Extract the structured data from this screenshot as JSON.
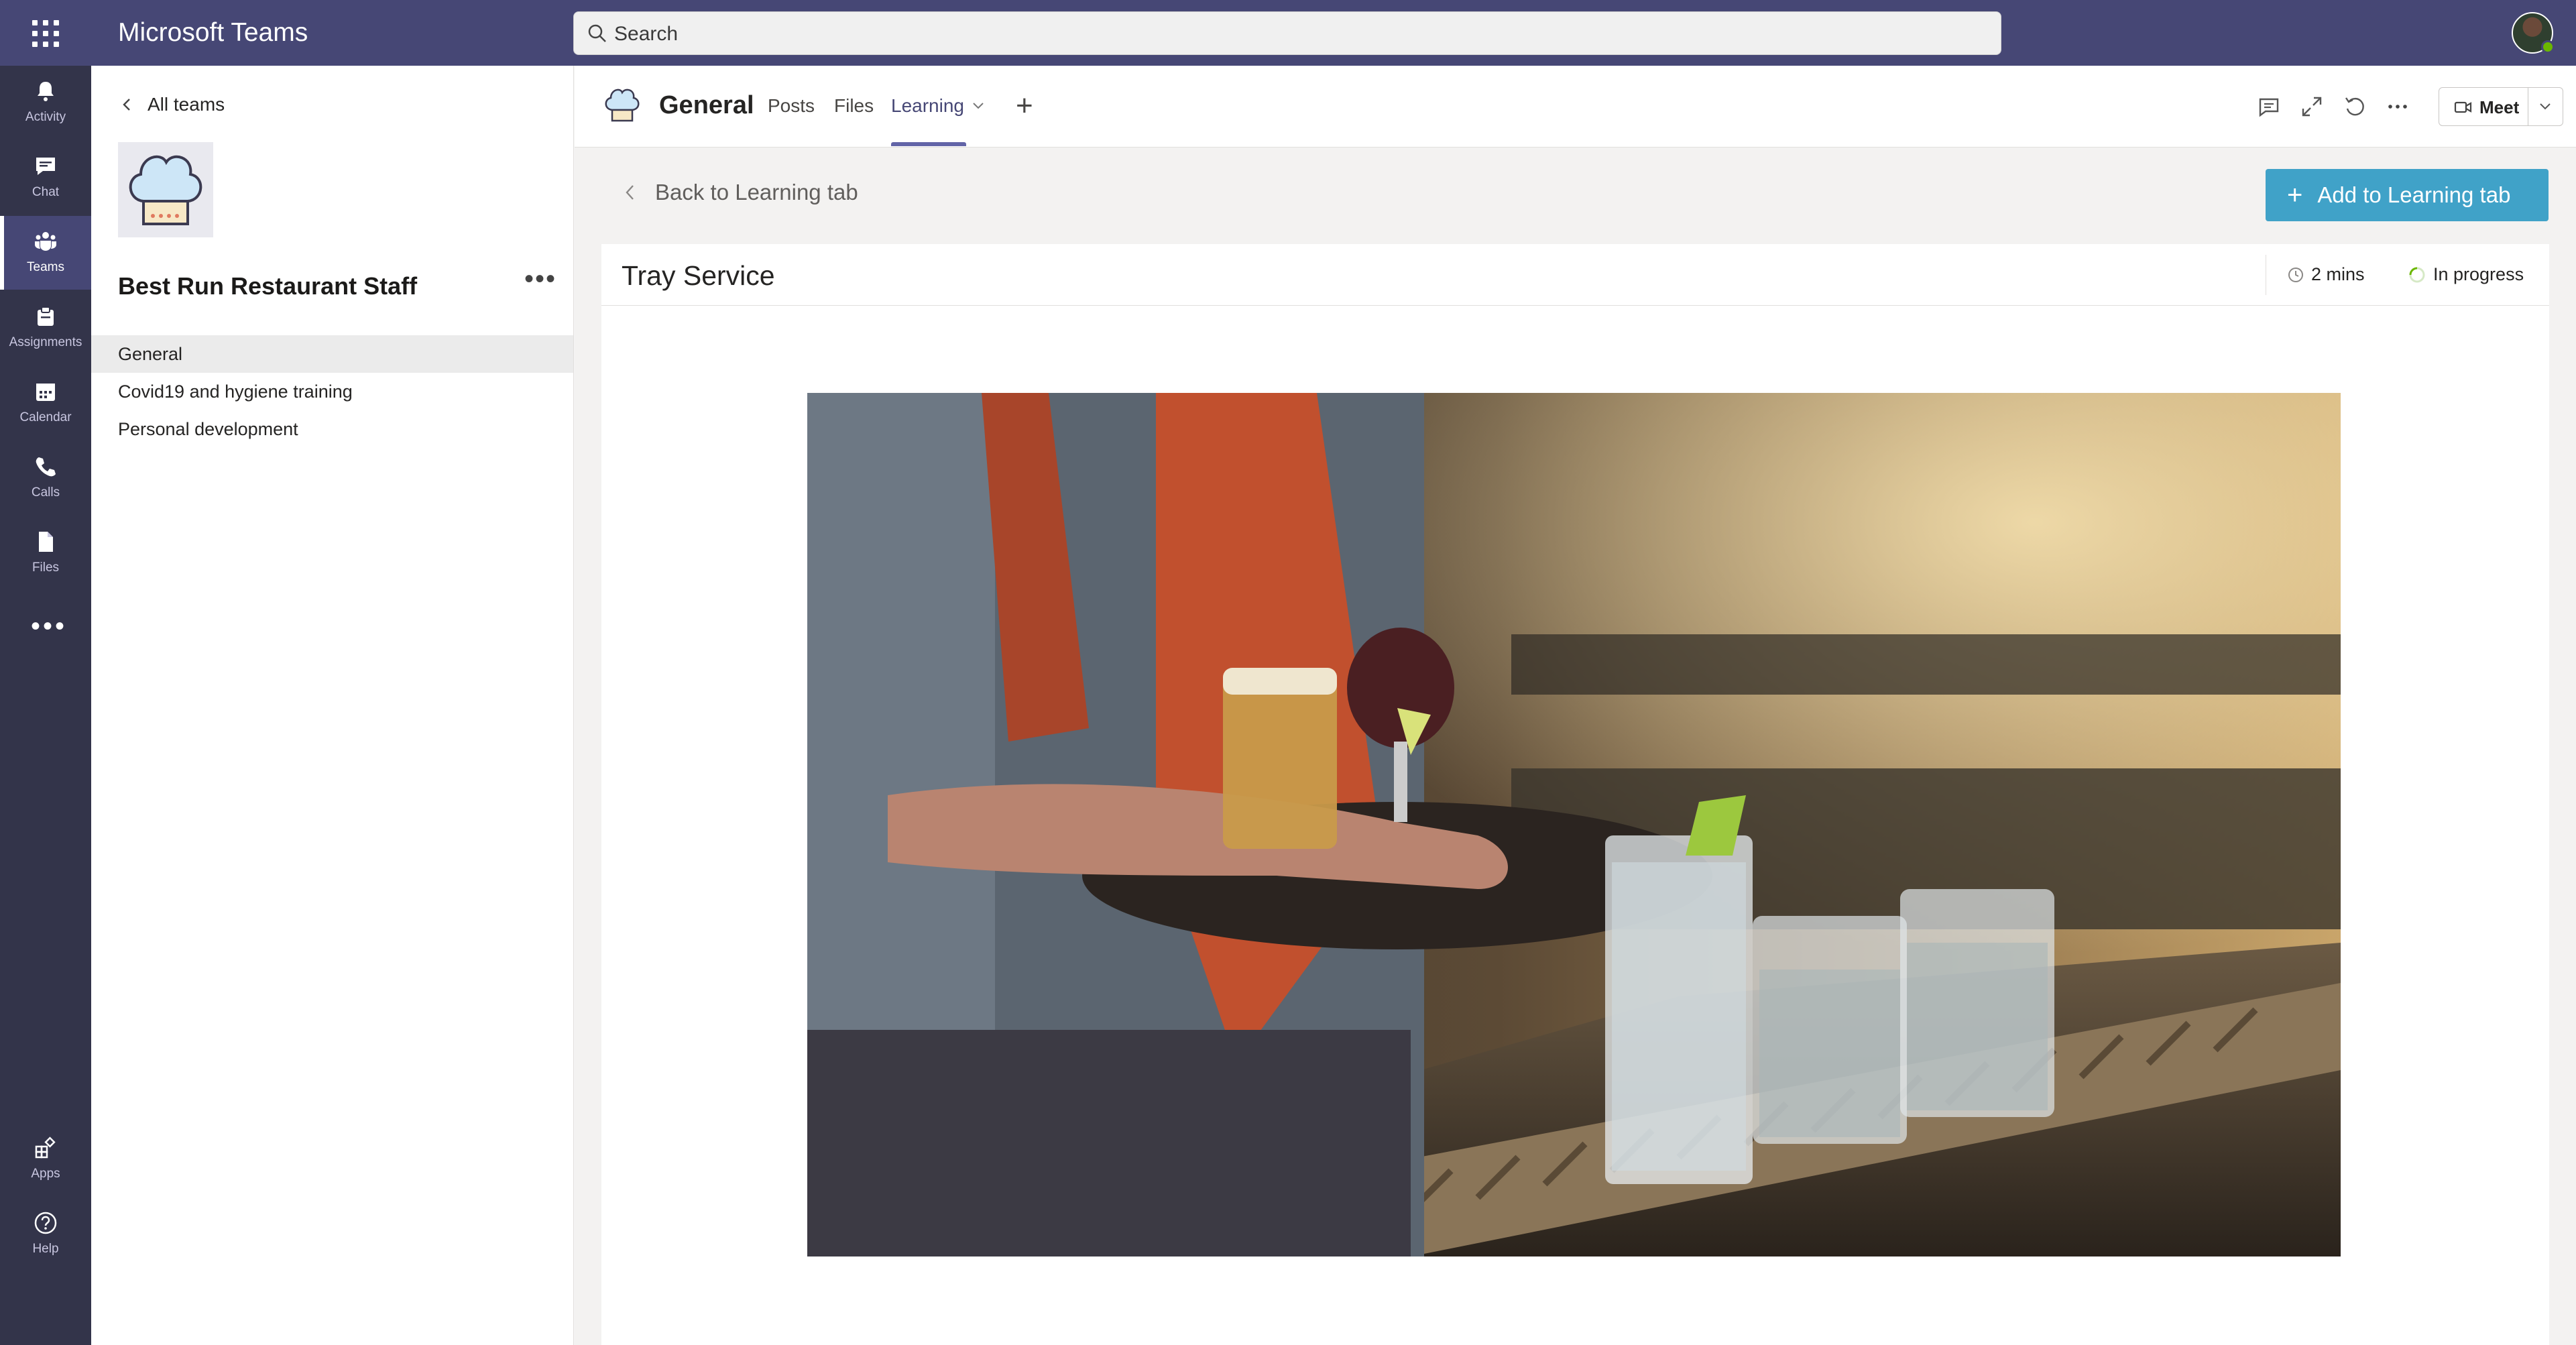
{
  "app": {
    "title": "Microsoft Teams"
  },
  "search": {
    "placeholder": "Search"
  },
  "rail": {
    "items": [
      {
        "label": "Activity",
        "icon": "bell-icon"
      },
      {
        "label": "Chat",
        "icon": "chat-icon"
      },
      {
        "label": "Teams",
        "icon": "teams-icon",
        "active": true
      },
      {
        "label": "Assignments",
        "icon": "assignments-icon"
      },
      {
        "label": "Calendar",
        "icon": "calendar-icon"
      },
      {
        "label": "Calls",
        "icon": "phone-icon"
      },
      {
        "label": "Files",
        "icon": "file-icon"
      },
      {
        "label": "Apps",
        "icon": "apps-icon"
      },
      {
        "label": "Help",
        "icon": "help-icon"
      }
    ],
    "more": "•••"
  },
  "team_panel": {
    "back_label": "All teams",
    "team_name": "Best Run Restaurant Staff",
    "more": "•••",
    "channels": [
      {
        "label": "General",
        "active": true
      },
      {
        "label": "Covid19 and hygiene training"
      },
      {
        "label": "Personal development"
      }
    ]
  },
  "header": {
    "channel_title": "General",
    "tabs": [
      {
        "label": "Posts"
      },
      {
        "label": "Files"
      },
      {
        "label": "Learning",
        "active": true
      }
    ],
    "meet_label": "Meet"
  },
  "content": {
    "back_label": "Back to Learning tab",
    "add_button_label": "Add to Learning tab",
    "card": {
      "title": "Tray Service",
      "duration": "2 mins",
      "status": "In progress"
    }
  },
  "colors": {
    "topbar": "#464775",
    "rail": "#33344a",
    "accent": "#6264a7",
    "add_button": "#40a2c8"
  }
}
